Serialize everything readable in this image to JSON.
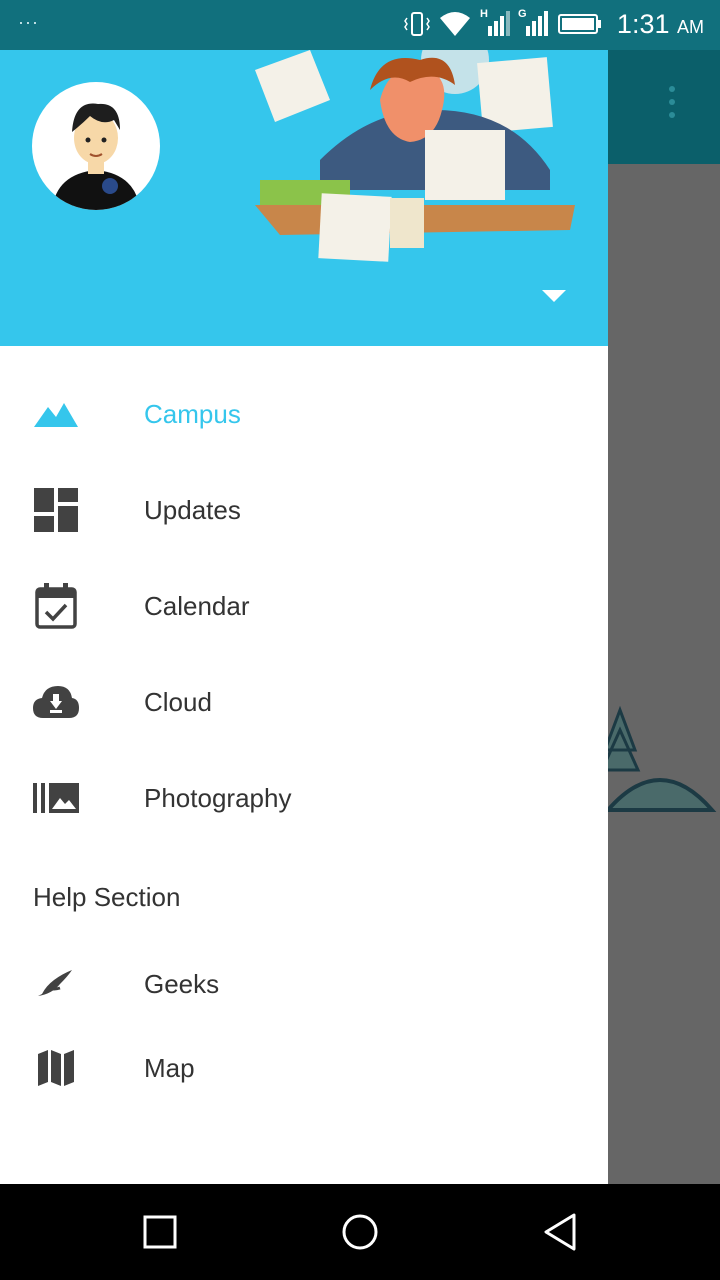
{
  "status_bar": {
    "notification_dots": "···",
    "network_1": "H",
    "network_2": "G",
    "time": "1:31",
    "ampm": "AM"
  },
  "drawer": {
    "items": [
      {
        "label": "Campus",
        "icon": "mountain-icon",
        "active": true
      },
      {
        "label": "Updates",
        "icon": "dashboard-icon",
        "active": false
      },
      {
        "label": "Calendar",
        "icon": "calendar-check-icon",
        "active": false
      },
      {
        "label": "Cloud",
        "icon": "cloud-download-icon",
        "active": false
      },
      {
        "label": "Photography",
        "icon": "photo-library-icon",
        "active": false
      }
    ],
    "help_section_title": "Help Section",
    "help_items": [
      {
        "label": "Geeks",
        "icon": "feather-icon"
      },
      {
        "label": "Map",
        "icon": "map-icon"
      }
    ]
  },
  "colors": {
    "accent": "#35c6ec",
    "status_bar": "#11707d",
    "toolbar_dim": "#0b5f6a",
    "text": "#333333",
    "icon": "#424242"
  }
}
